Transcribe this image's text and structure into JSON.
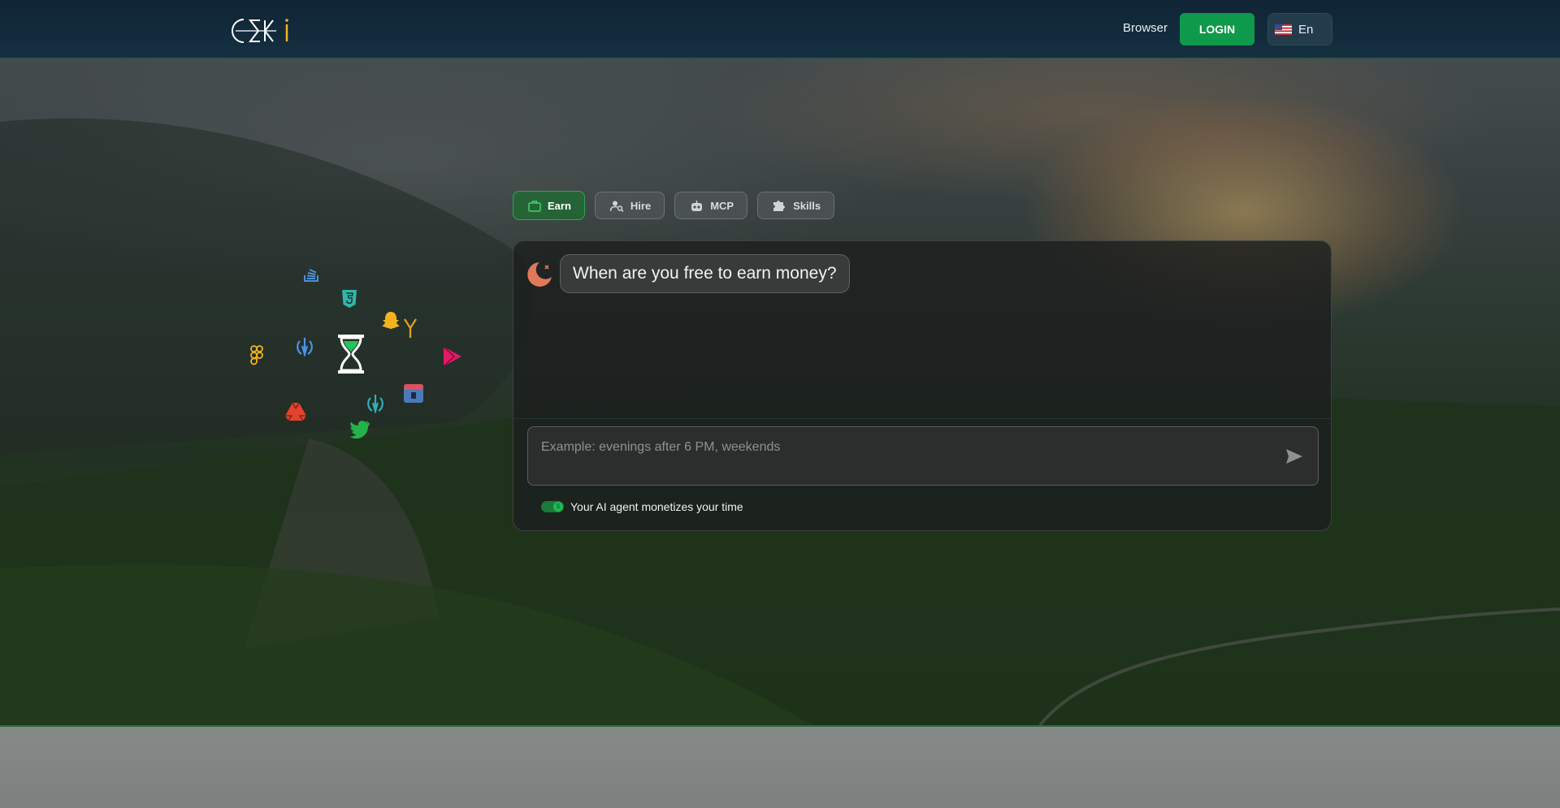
{
  "navbar": {
    "logo_text": "CEKi",
    "browser_link": "Browser",
    "login_label": "LOGIN",
    "language_label": "En"
  },
  "tabs": [
    {
      "label": "Earn",
      "icon": "briefcase-icon",
      "active": true
    },
    {
      "label": "Hire",
      "icon": "person-search-icon",
      "active": false
    },
    {
      "label": "MCP",
      "icon": "robot-icon",
      "active": false
    },
    {
      "label": "Skills",
      "icon": "puzzle-icon",
      "active": false
    }
  ],
  "chat": {
    "question": "When are you free to earn money?",
    "answer_placeholder": "Example: evenings after 6 PM, weekends",
    "toggle_label": "Your AI agent monetizes your time"
  },
  "orbit_icons": [
    "stack-overflow-icon",
    "html5-icon",
    "snapchat-icon",
    "y-combinator-icon",
    "figma-icon",
    "jedi-order-icon",
    "hourglass-icon",
    "google-play-icon",
    "google-drive-icon",
    "jedi-order-icon",
    "calendar-icon",
    "twitter-icon"
  ],
  "colors": {
    "accent_green": "#0e9a4a",
    "navbar_bg": "#102436",
    "hourglass_fill": "#21c45a"
  }
}
